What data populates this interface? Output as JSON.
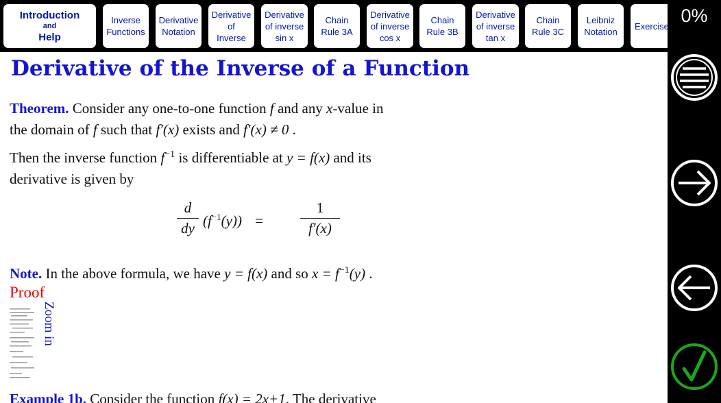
{
  "tabs": [
    {
      "id": "intro",
      "lines": [
        "Introduction",
        "and",
        "Help"
      ]
    },
    {
      "id": "inverse-functions",
      "lines": [
        "Inverse",
        "Functions"
      ]
    },
    {
      "id": "derivative-notation",
      "lines": [
        "Derivative",
        "Notation"
      ]
    },
    {
      "id": "derivative-of-inverse",
      "lines": [
        "Derivative",
        "of",
        "Inverse"
      ]
    },
    {
      "id": "derivative-inverse-sin",
      "lines": [
        "Derivative",
        "of inverse",
        "sin x"
      ]
    },
    {
      "id": "chain-rule-3a",
      "lines": [
        "Chain",
        "Rule 3A"
      ]
    },
    {
      "id": "derivative-inverse-cos",
      "lines": [
        "Derivative",
        "of inverse",
        "cos x"
      ]
    },
    {
      "id": "chain-rule-3b",
      "lines": [
        "Chain",
        "Rule 3B"
      ]
    },
    {
      "id": "derivative-inverse-tan",
      "lines": [
        "Derivative",
        "of inverse",
        "tan x"
      ]
    },
    {
      "id": "chain-rule-3c",
      "lines": [
        "Chain",
        "Rule 3C"
      ]
    },
    {
      "id": "leibniz-notation",
      "lines": [
        "Leibniz",
        "Notation"
      ]
    },
    {
      "id": "exercises",
      "lines": [
        "Exercise"
      ]
    }
  ],
  "progress": {
    "label": "0%",
    "value": 0
  },
  "right_buttons": [
    "menu-icon",
    "arrow-right-icon",
    "arrow-left-icon",
    "checkmark-icon"
  ],
  "page": {
    "title": "Derivative of the Inverse of a Function",
    "theorem_label": "Theorem.",
    "theorem_text_1a": " Consider any one-to-one function ",
    "theorem_f": "f",
    "theorem_text_1b": " and any ",
    "theorem_x": "x",
    "theorem_text_1c": "-value in",
    "theorem_line2a": "the domain of ",
    "theorem_line2b": " such that ",
    "theorem_fprime": "f′(x)",
    "theorem_line2c": " exists and ",
    "theorem_neq": "f′(x) ≠ 0",
    "theorem_line2d": " .",
    "then_line1a": "Then the inverse function ",
    "then_finv": "f",
    "then_sup": "−1",
    "then_line1b": " is differentiable at ",
    "then_eq": "y = f(x)",
    "then_line1c": " and its",
    "then_line2": "derivative is given by",
    "formula_num_d": "d",
    "formula_den_dy": "dy",
    "formula_lhs": "(f",
    "formula_lhs_sup": "−1",
    "formula_lhs_end": "(y))",
    "formula_eq": "=",
    "formula_num_1": "1",
    "formula_den_fprime": "f′(x)",
    "note_label": "Note.",
    "note_text_a": " In the above formula, we have ",
    "note_eq1": "y = f(x)",
    "note_text_b": " and so ",
    "note_eq2a": "x = f",
    "note_eq2_sup": "−1",
    "note_eq2b": "(y)",
    "note_text_c": " .",
    "proof_link": "Proof",
    "zoom_link": "Zoom in",
    "example_label": "Example 1b.",
    "example_text_a": " Consider the function ",
    "example_eq": "f(x) = 2x+1",
    "example_text_b": ". The derivative"
  },
  "colors": {
    "accent": "#1414d2",
    "proof": "#e00000",
    "tab_text": "#0018a8",
    "check": "#1aa81a"
  }
}
